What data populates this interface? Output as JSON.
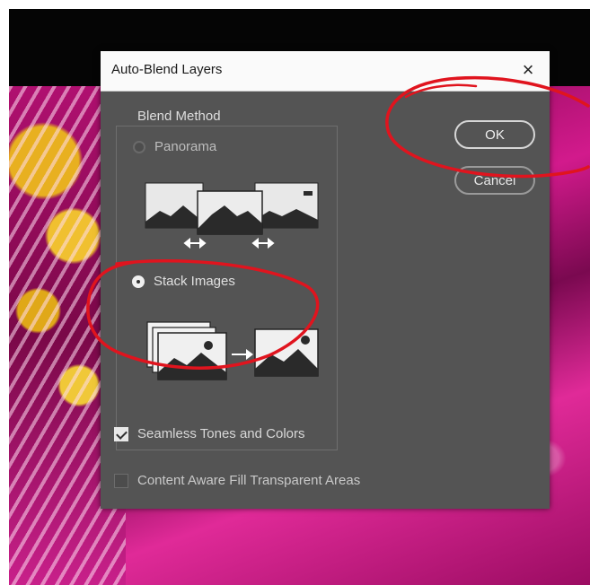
{
  "dialog": {
    "title": "Auto-Blend Layers",
    "close_glyph": "×",
    "blend_method": {
      "legend": "Blend Method",
      "options": [
        {
          "label": "Panorama",
          "selected": false
        },
        {
          "label": "Stack Images",
          "selected": true
        }
      ]
    },
    "checkboxes": [
      {
        "label": "Seamless Tones and Colors",
        "checked": true
      },
      {
        "label": "Content Aware Fill Transparent Areas",
        "checked": false
      }
    ],
    "buttons": {
      "ok": "OK",
      "cancel": "Cancel"
    }
  },
  "icons": {
    "close": "close-icon",
    "panorama": "panorama-illustration-icon",
    "stack": "stack-images-illustration-icon",
    "resize": "resize-arrow-icon",
    "arrow": "arrow-right-icon"
  },
  "colors": {
    "dialog_bg": "#545454",
    "titlebar_bg": "#fafafa",
    "annotation": "#e0141e",
    "canvas_accent": "#c4127c"
  }
}
